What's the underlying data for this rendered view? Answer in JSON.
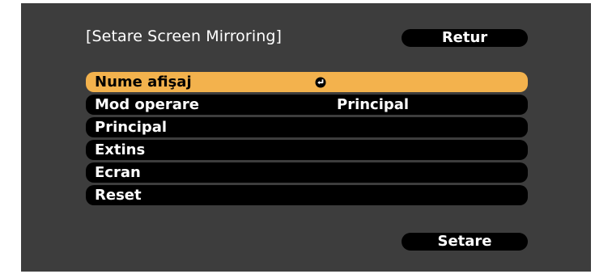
{
  "dialog": {
    "title": "[Setare Screen Mirroring]",
    "back_label": "Retur",
    "set_label": "Setare"
  },
  "menu": {
    "selected_index": 0,
    "items": [
      {
        "label": "Nume afişaj",
        "value": "",
        "icon": "enter-icon"
      },
      {
        "label": "Mod operare",
        "value": "Principal"
      },
      {
        "label": "Principal",
        "value": ""
      },
      {
        "label": "Extins",
        "value": ""
      },
      {
        "label": "Ecran",
        "value": ""
      },
      {
        "label": "Reset",
        "value": ""
      }
    ]
  },
  "colors": {
    "panel_bg": "#3d3d3d",
    "row_bg": "#000000",
    "highlight": "#f3b24d",
    "text": "#ffffff",
    "page_bg": "#ffffff"
  }
}
